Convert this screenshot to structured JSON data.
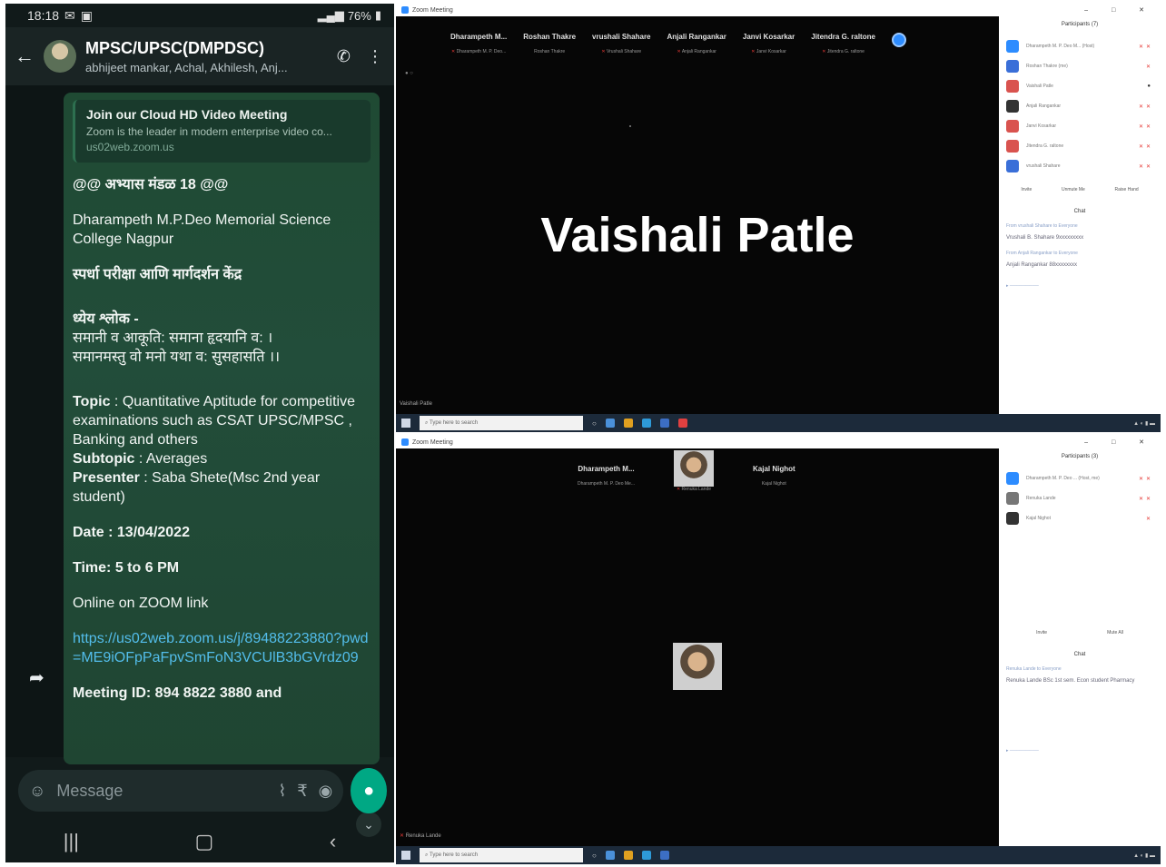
{
  "phone": {
    "status": {
      "time": "18:18",
      "battery": "76%"
    },
    "header": {
      "group_name": "MPSC/UPSC(DMPDSC)",
      "members": "abhijeet mankar, Achal, Akhilesh, Anj..."
    },
    "link_preview": {
      "title": "Join our Cloud HD Video Meeting",
      "description": "Zoom is the leader in modern enterprise video co...",
      "url": "us02web.zoom.us"
    },
    "message": {
      "line1": "@@  अभ्यास मंडळ 18 @@",
      "college": "Dharampeth M.P.Deo Memorial Science College Nagpur",
      "center": "स्पर्धा परीक्षा आणि मार्गदर्शन केंद्र",
      "motto_label": "ध्येय श्लोक -",
      "motto_1": "समानी व आकूति: समाना हृदयानि व: ।",
      "motto_2": "समानमस्तु वो मनो यथा व: सुसहासति ।।",
      "topic_label": "Topic",
      "topic": " : Quantitative Aptitude for competitive examinations such as CSAT UPSC/MPSC , Banking and others",
      "subtopic_label": "Subtopic",
      "subtopic": " : Averages",
      "presenter_label": "Presenter",
      "presenter": " : Saba Shete(Msc 2nd year student)",
      "date": "Date : 13/04/2022",
      "time": "Time: 5 to 6 PM",
      "online": "Online on ZOOM link",
      "link": "https://us02web.zoom.us/j/89488223880?pwd=ME9iOFpPaFpvSmFoN3VCUlB3bGVrdz09",
      "cutoff": "Meeting ID: 894 8822 3880 and"
    },
    "composer": {
      "placeholder": "Message"
    }
  },
  "zoom_top": {
    "title": "Zoom Meeting",
    "speaker": "Vaishali Patle",
    "bottom_label": "Vaishali Patle",
    "strip": [
      {
        "name": "Dharampeth M...",
        "sub": "Dharampeth M. P. Deo..."
      },
      {
        "name": "Roshan Thakre",
        "sub": "Roshan Thakre"
      },
      {
        "name": "vrushali Shahare",
        "sub": "Vrushali Shahare"
      },
      {
        "name": "Anjali Rangankar",
        "sub": "Anjali Rangankar"
      },
      {
        "name": "Janvi Kosarkar",
        "sub": "Janvi Kosarkar"
      },
      {
        "name": "Jitendra G. raltone",
        "sub": "Jitendra G. raltone"
      }
    ],
    "panel_title": "Participants (7)",
    "participants": [
      {
        "name": "Dharampeth M. P. Deo M... (Host)",
        "color": "#2d8cff"
      },
      {
        "name": "Roshan Thakre (me)",
        "color": "#3a6fd8"
      },
      {
        "name": "Vaishali Patle",
        "color": "#d9534f"
      },
      {
        "name": "Anjali Rangankar",
        "color": "#333333"
      },
      {
        "name": "Janvi Kosarkar",
        "color": "#d9534f"
      },
      {
        "name": "Jitendra G. raltone",
        "color": "#d9534f"
      },
      {
        "name": "vrushali Shahare",
        "color": "#3a6fd8"
      }
    ],
    "panel_buttons": [
      "Invite",
      "Unmute Me",
      "Raise Hand"
    ],
    "chat_title": "Chat",
    "chat": [
      {
        "from": "From vrushali Shahare to Everyone",
        "text": "Vrushali B. Shahare 9xxxxxxxxx"
      },
      {
        "from": "From Anjali Rangankar to Everyone",
        "text": "Anjali Rangankar 88xxxxxxxx"
      }
    ]
  },
  "zoom_bottom": {
    "title": "Zoom Meeting",
    "bottom_label": "Renuka Lande",
    "strip": [
      {
        "name": "Dharampeth M...",
        "sub": "Dharampeth M. P. Deo Me..."
      },
      {
        "name": "",
        "sub": "Renuka Lande"
      },
      {
        "name": "Kajal Nighot",
        "sub": "Kajal Nighot"
      }
    ],
    "panel_title": "Participants (3)",
    "participants": [
      {
        "name": "Dharampeth M. P. Deo ... (Host, me)",
        "color": "#2d8cff"
      },
      {
        "name": "Renuka Lande",
        "color": "#777777"
      },
      {
        "name": "Kajal Nighot",
        "color": "#333333"
      }
    ],
    "panel_buttons": [
      "Invite",
      "Mute All"
    ],
    "chat_title": "Chat",
    "chat": [
      {
        "from": "Renuka Lande to Everyone",
        "text": "Renuka Lande BSc 1st sem. Econ student Pharmacy"
      }
    ]
  },
  "taskbar": {
    "search_placeholder": "Type here to search"
  }
}
